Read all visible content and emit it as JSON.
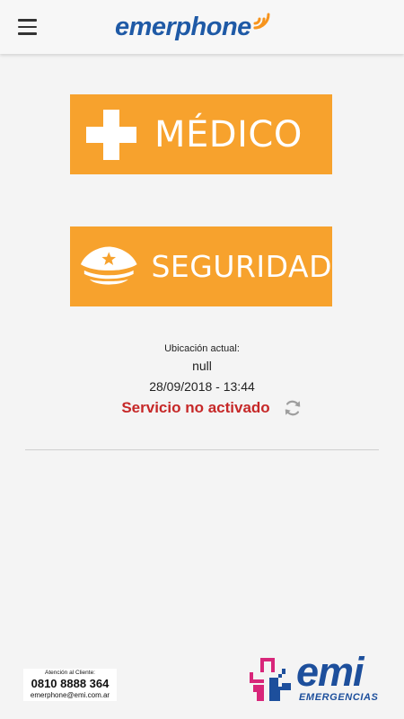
{
  "header": {
    "brand": "emerphone",
    "menu_icon": "hamburger-menu-icon"
  },
  "actions": {
    "medico": {
      "label": "MÉDICO",
      "icon": "medical-cross-icon",
      "color": "#f7a22d"
    },
    "seguridad": {
      "label": "SEGURIDAD",
      "icon": "police-cap-icon",
      "color": "#f7a22d"
    }
  },
  "status": {
    "location_label": "Ubicación actual:",
    "location_value": "null",
    "datetime": "28/09/2018 - 13:44",
    "service_text": "Servicio no activado",
    "service_color": "#c62828",
    "refresh_icon": "refresh-icon"
  },
  "footer": {
    "contact_label": "Atención al Cliente:",
    "phone": "0810 8888 364",
    "email": "emerphone@emi.com.ar",
    "logo_word": "emi",
    "logo_sub": "EMERGENCIAS"
  }
}
